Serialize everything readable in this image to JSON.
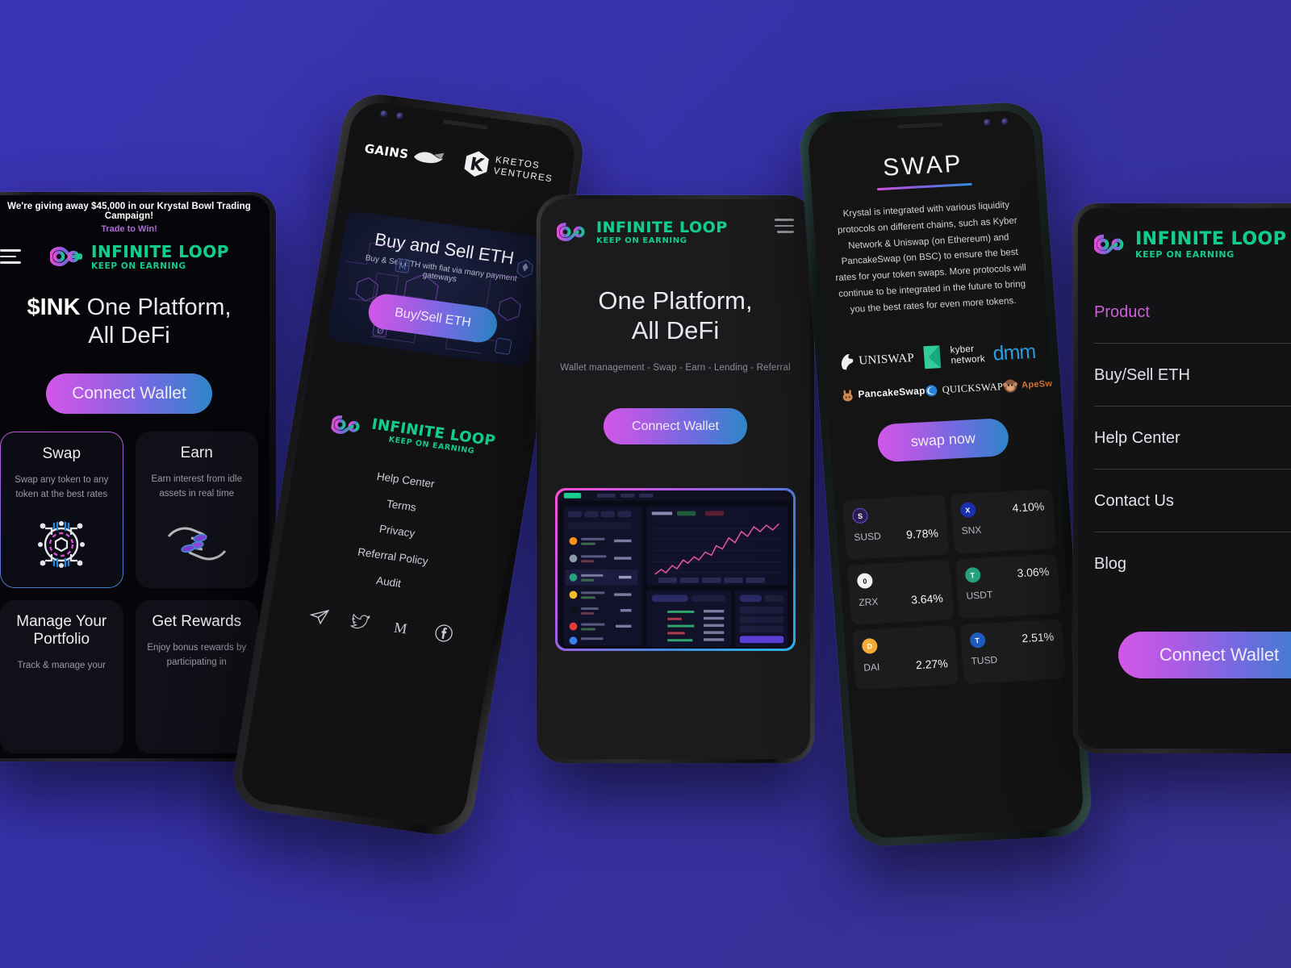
{
  "background": {
    "color_start": "#3b34b4",
    "color_end": "#3a3396"
  },
  "brand": {
    "name": "INFINITE LOOP",
    "tagline": "KEEP ON EARNING",
    "logo_icon": "infinity-loop-icon",
    "green": "#12cc8c",
    "gradient": [
      "#d257e8",
      "#2e86c8"
    ]
  },
  "phone1": {
    "banner": {
      "headline": "We're giving away $45,000 in our Krystal Bowl Trading Campaign!",
      "cta": "Trade to Win!"
    },
    "menu_icon": "hamburger-menu-icon",
    "hero_prefix": "$INK",
    "hero_line1": "One Platform,",
    "hero_line2": "All DeFi",
    "connect_label": "Connect Wallet",
    "cards": [
      {
        "title": "Swap",
        "desc": "Swap any token to any token at the best rates",
        "icon": "swap-network-icon",
        "active": true
      },
      {
        "title": "Earn",
        "desc": "Earn interest from idle assets in real time",
        "icon": "hands-coins-icon",
        "active": false
      },
      {
        "title": "Manage Your Portfolio",
        "desc": "Track & manage your",
        "icon": "portfolio-icon",
        "active": false
      },
      {
        "title": "Get Rewards",
        "desc": "Enjoy bonus rewards by participating in",
        "icon": "rewards-icon",
        "active": false
      }
    ]
  },
  "phone2": {
    "partner_left": "GAINS",
    "partner_left_icon": "gains-whale-icon",
    "partner_right_line1": "KRETOS",
    "partner_right_line2": "VENTURES",
    "partner_right_icon": "kretos-k-icon",
    "promo_title": "Buy and Sell ETH",
    "promo_sub": "Buy & Sell ETH with fiat via many payment gateways",
    "promo_button": "Buy/Sell ETH",
    "footer_links": [
      "Help Center",
      "Terms",
      "Privacy",
      "Referral Policy",
      "Audit"
    ],
    "socials": [
      "telegram-icon",
      "twitter-icon",
      "medium-icon",
      "facebook-icon"
    ]
  },
  "phone3": {
    "menu_icon": "hamburger-menu-icon",
    "hero_line1": "One Platform,",
    "hero_line2": "All DeFi",
    "subtitle": "Wallet management - Swap - Earn - Lending - Referral",
    "connect_label": "Connect Wallet",
    "screenshot_name": "trading-dashboard-screenshot"
  },
  "phone4": {
    "title": "SWAP",
    "description": "Krystal is integrated with various liquidity protocols on different chains, such as Kyber Network & Uniswap (on Ethereum) and PancakeSwap (on BSC) to ensure the best rates for your token swaps. More protocols will continue to be integrated in the future to bring you the best rates for even more tokens.",
    "protocols_row1": [
      {
        "name": "UNISWAP",
        "icon": "uniswap-unicorn-icon"
      },
      {
        "name": "kyber network",
        "icon": "kyber-k-icon"
      },
      {
        "name": "dmm",
        "icon": "dmm-icon"
      }
    ],
    "protocols_row2": [
      {
        "name": "PancakeSwap",
        "icon": "pancakeswap-rabbit-icon"
      },
      {
        "name": "QUICKSWAP",
        "icon": "quickswap-icon"
      },
      {
        "name": "ApeSwap",
        "icon": "apeswap-monkey-icon"
      }
    ],
    "swap_button": "swap now",
    "tokens": [
      {
        "symbol": "SUSD",
        "rate": "9.78%",
        "color": "#2d1b52",
        "glyph": "S"
      },
      {
        "symbol": "SNX",
        "rate": "4.10%",
        "color": "#1a2fb0",
        "glyph": "X"
      },
      {
        "symbol": "ZRX",
        "rate": "3.64%",
        "color": "#0e0e10",
        "glyph": "0"
      },
      {
        "symbol": "USDT",
        "rate": "3.06%",
        "color": "#26a17b",
        "glyph": "T"
      },
      {
        "symbol": "DAI",
        "rate": "2.27%",
        "color": "#f5ac37",
        "glyph": "D"
      },
      {
        "symbol": "TUSD",
        "rate": "2.51%",
        "color": "#1c5bbd",
        "glyph": "T"
      }
    ]
  },
  "phone5": {
    "menu_items": [
      {
        "label": "Product",
        "accent": true
      },
      {
        "label": "Buy/Sell ETH",
        "accent": false
      },
      {
        "label": "Help Center",
        "accent": false
      },
      {
        "label": "Contact Us",
        "accent": false
      },
      {
        "label": "Blog",
        "accent": false
      }
    ],
    "connect_label": "Connect Wallet"
  }
}
